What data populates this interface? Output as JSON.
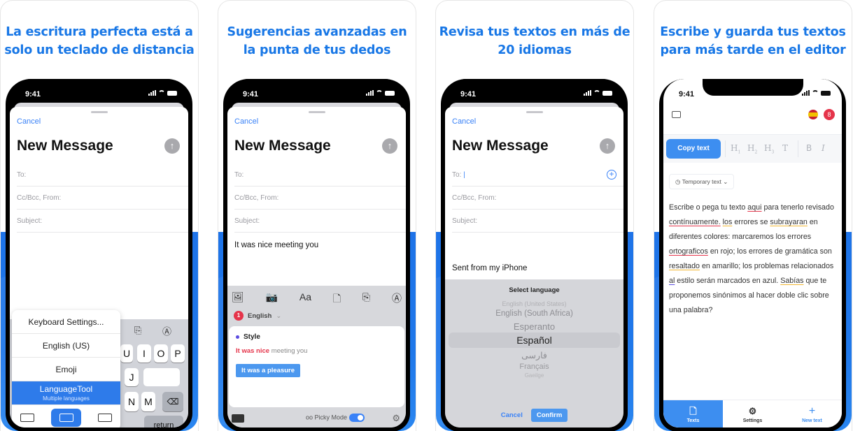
{
  "panels": [
    {
      "headline_line1": "La escritura perfecta está a",
      "headline_line2": "solo un teclado de distancia",
      "status_time": "9:41",
      "cancel": "Cancel",
      "title": "New Message",
      "fields": [
        "To:",
        "Cc/Bcc, From:",
        "Subject:"
      ],
      "keyboard_menu": {
        "items": [
          "Keyboard Settings...",
          "English (US)",
          "Emoji"
        ],
        "selected_label": "LanguageTool",
        "selected_sub": "Multiple languages"
      },
      "keys": [
        "U",
        "I",
        "O",
        "P",
        "J",
        "N",
        "M",
        "return"
      ]
    },
    {
      "headline_line1": "Sugerencias avanzadas en",
      "headline_line2": "la punta de tus dedos",
      "status_time": "9:41",
      "cancel": "Cancel",
      "title": "New Message",
      "fields": [
        "To:",
        "Cc/Bcc, From:",
        "Subject:"
      ],
      "body": "It was nice meeting you",
      "toolbar_icons": [
        "photo-library-icon",
        "camera-icon",
        "text-format-icon",
        "document-icon",
        "scan-icon",
        "markup-icon"
      ],
      "toolbar_aa": "Aa",
      "error_count": "1",
      "language": "English",
      "suggestion": {
        "category": "Style",
        "error_text": "It was nice",
        "rest_text": " meeting you",
        "replacement": "It was a pleasure"
      },
      "picky_mode_label": "Picky Mode",
      "picky_mode_on": true
    },
    {
      "headline_line1": "Revisa tus textos en más de",
      "headline_line2": "20 idiomas",
      "status_time": "9:41",
      "cancel": "Cancel",
      "title": "New Message",
      "fields": [
        "To:",
        "Cc/Bcc, From:",
        "Subject:"
      ],
      "body": "Sent from my iPhone",
      "picker": {
        "title": "Select language",
        "options": [
          "English (United States)",
          "English (South Africa)",
          "Esperanto",
          "Español",
          "فارسی",
          "Français",
          "Gaeilge"
        ],
        "selected": "Español",
        "cancel": "Cancel",
        "confirm": "Confirm"
      }
    },
    {
      "headline_line1": "Escribe y guarda tus textos",
      "headline_line2": "para más tarde en el editor",
      "status_time": "9:41",
      "error_count": "8",
      "copy_text": "Copy text",
      "format_tools": [
        "H1",
        "H2",
        "H3",
        "T",
        "B",
        "I"
      ],
      "temp_label": "Temporary text",
      "editor_segments": [
        {
          "t": "Escribe o pega tu texto ",
          "u": ""
        },
        {
          "t": "aqui",
          "u": "r"
        },
        {
          "t": " para tenerlo revisado ",
          "u": ""
        },
        {
          "t": "contínuamente.",
          "u": "r"
        },
        {
          "t": " ",
          "u": ""
        },
        {
          "t": "los",
          "u": "y"
        },
        {
          "t": " errores se ",
          "u": ""
        },
        {
          "t": "subrayaran",
          "u": "y"
        },
        {
          "t": " en diferentes colores: marcaremos los errores ",
          "u": ""
        },
        {
          "t": "ortograficos",
          "u": "r"
        },
        {
          "t": " en rojo; los errores de gramática son ",
          "u": ""
        },
        {
          "t": "resaltado",
          "u": "y"
        },
        {
          "t": " en amarillo; los problemas relacionados ",
          "u": ""
        },
        {
          "t": "al",
          "u": "b"
        },
        {
          "t": " estilo serán marcados en azul. ",
          "u": ""
        },
        {
          "t": "Sabías",
          "u": "y"
        },
        {
          "t": " que te proponemos sinónimos al hacer doble clic sobre una palabra?",
          "u": ""
        }
      ],
      "tabs": [
        {
          "label": "Texts",
          "icon": "document-icon",
          "active": true
        },
        {
          "label": "Settings",
          "icon": "gear-icon",
          "active": false
        },
        {
          "label": "New text",
          "icon": "plus-icon",
          "active": false
        }
      ]
    }
  ],
  "colors": {
    "brand_blue": "#1877e6",
    "error_red": "#e5344a",
    "grammar_yellow": "#f2b731",
    "style_purple": "#5b4be0"
  }
}
